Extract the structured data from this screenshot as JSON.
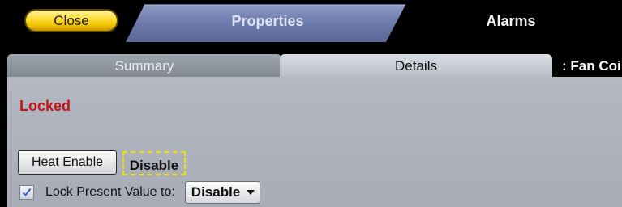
{
  "top_tabs": {
    "close_label": "Close",
    "properties_label": "Properties",
    "alarms_label": "Alarms"
  },
  "sub_tabs": [
    {
      "label": "Summary",
      "selected": false
    },
    {
      "label": "Details",
      "selected": true
    },
    {
      "label": ": Fan Coi",
      "selected": false
    }
  ],
  "details": {
    "status": "Locked",
    "command_button": "Heat Enable",
    "current_value": "Disable",
    "lock_checkbox_checked": true,
    "lock_label": "Lock Present Value to:",
    "lock_value": "Disable"
  },
  "colors": {
    "status_red": "#c5141a",
    "properties_tab_blue": "#6a78a8",
    "close_button_yellow": "#ffe34a",
    "focus_dashed_yellow": "#f0e000",
    "checkmark_blue": "#3a5fc8"
  },
  "icons": {
    "checkbox_mark": "checkmark-icon",
    "select_caret": "chevron-down-icon"
  }
}
